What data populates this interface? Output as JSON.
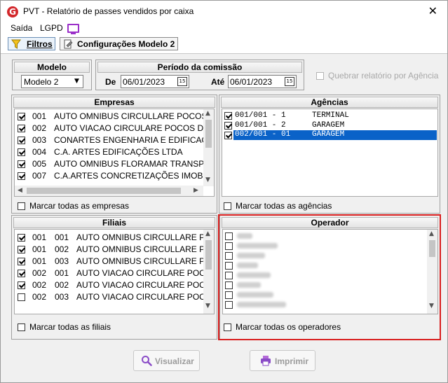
{
  "window": {
    "title": "PVT - Relatório de passes vendidos por caixa",
    "close_label": "✕"
  },
  "menu": {
    "items": [
      "Saída",
      "LGPD"
    ]
  },
  "tabs": [
    {
      "label": "Filtros",
      "icon": "filter-icon",
      "active": true
    },
    {
      "label": "Configurações Modelo 2",
      "icon": "settings-doc-icon",
      "active": false
    }
  ],
  "modelo": {
    "header": "Modelo",
    "value": "Modelo 2"
  },
  "periodo": {
    "header": "Período da comissão",
    "de_label": "De",
    "de_value": "06/01/2023",
    "ate_label": "Até",
    "ate_value": "06/01/2023",
    "cal_label": "15"
  },
  "agencia_option": {
    "label": "Quebrar relatório por Agência",
    "checked": false,
    "enabled": false
  },
  "empresas": {
    "header": "Empresas",
    "rows": [
      {
        "checked": true,
        "code": "001",
        "name": "AUTO OMNIBUS CIRCULLARE POCOS DE"
      },
      {
        "checked": true,
        "code": "002",
        "name": "AUTO VIACAO CIRCULARE POCOS DE CA"
      },
      {
        "checked": true,
        "code": "003",
        "name": "CONARTES ENGENHARIA E EDIFICAÇÃO."
      },
      {
        "checked": true,
        "code": "004",
        "name": "C.A. ARTES EDIFICAÇÕES LTDA"
      },
      {
        "checked": true,
        "code": "005",
        "name": "AUTO OMNIBUS FLORAMAR TRANSPOR."
      },
      {
        "checked": true,
        "code": "007",
        "name": "C.A.ARTES CONCRETIZAÇÕES IMOBILIAF"
      }
    ],
    "mark_all": "Marcar todas as empresas"
  },
  "agencias": {
    "header": "Agências",
    "rows": [
      {
        "checked": true,
        "code": "001/001 - 1",
        "name": "TERMINAL",
        "selected": false
      },
      {
        "checked": true,
        "code": "001/001 - 2",
        "name": "GARAGEM",
        "selected": false
      },
      {
        "checked": true,
        "code": "002/001 - 01",
        "name": "GARAGEM",
        "selected": true
      }
    ],
    "mark_all": "Marcar todas as agências"
  },
  "filiais": {
    "header": "Filiais",
    "rows": [
      {
        "checked": true,
        "emp": "001",
        "code": "001",
        "name": "AUTO OMNIBUS CIRCULLARE POC."
      },
      {
        "checked": true,
        "emp": "001",
        "code": "002",
        "name": "AUTO OMNIBUS CIRCULLARE POC."
      },
      {
        "checked": true,
        "emp": "001",
        "code": "003",
        "name": "AUTO OMNIBUS CIRCULLARE POC."
      },
      {
        "checked": true,
        "emp": "002",
        "code": "001",
        "name": "AUTO VIACAO CIRCULARE POCOS"
      },
      {
        "checked": true,
        "emp": "002",
        "code": "002",
        "name": "AUTO VIACAO CIRCULARE POCOS"
      },
      {
        "checked": false,
        "emp": "002",
        "code": "003",
        "name": "AUTO VIACAO CIRCULARE POCOS"
      }
    ],
    "mark_all": "Marcar todas as filiais"
  },
  "operador": {
    "header": "Operador",
    "row_count": 8,
    "mark_all": "Marcar todas os operadores",
    "highlight_color": "#d81e1e"
  },
  "actions": {
    "visualizar": "Visualizar",
    "imprimir": "Imprimir"
  },
  "colors": {
    "selection": "#0a62c8",
    "brand": "#d3272b",
    "lgpd_icon": "#9b2fc9"
  }
}
